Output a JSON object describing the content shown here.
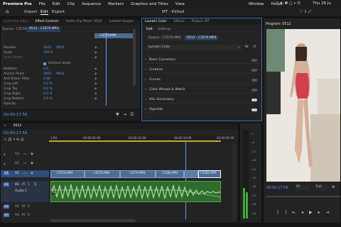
{
  "menubar": {
    "app": "Premiere Pro",
    "items": [
      "File",
      "Edit",
      "Clip",
      "Sequence",
      "Markers",
      "Graphics and Titles",
      "View",
      "Window",
      "Help"
    ],
    "datetime": "Thu 26 Ju"
  },
  "header": {
    "home_icon": "home-icon",
    "tabs": [
      "Import",
      "Edit",
      "Export"
    ],
    "active_tab": "Edit",
    "title": "MT - Edited"
  },
  "effect_controls": {
    "tabs": [
      "Effect Controls",
      "Audio Clip Mixer: 0512",
      "Lumetri Scopes"
    ],
    "source": "Source · C3579.MP4",
    "sequence": "0512 · C3579.MP4",
    "clip_label": "C3579.MP4",
    "rows": [
      {
        "label": "Position",
        "v1": "1852",
        "v2": "9952"
      },
      {
        "label": "Scale",
        "v1": "100.0",
        "v2": ""
      },
      {
        "label": "Scale Width",
        "v1": "",
        "v2": ""
      },
      {
        "label": "Uniform Scale",
        "v1": "",
        "v2": ""
      },
      {
        "label": "Rotation",
        "v1": "0.0",
        "v2": ""
      },
      {
        "label": "Anchor Point",
        "v1": "1852",
        "v2": "9952"
      },
      {
        "label": "Anti-flicker Filter",
        "v1": "0.00",
        "v2": ""
      },
      {
        "label": "Crop Left",
        "v1": "0.0 %",
        "v2": ""
      },
      {
        "label": "Crop Top",
        "v1": "0.0 %",
        "v2": ""
      },
      {
        "label": "Crop Right",
        "v1": "0.0 %",
        "v2": ""
      },
      {
        "label": "Crop Bottom",
        "v1": "0.0 %",
        "v2": ""
      },
      {
        "label": "Opacity",
        "v1": "",
        "v2": ""
      }
    ],
    "timecode": "00:00:17:56"
  },
  "lumetri": {
    "tabs": [
      "Lumetri Color",
      "Effects",
      "Project: MT"
    ],
    "subtabs": [
      "Edit",
      "Settings"
    ],
    "source": "Source - C3579.MP4",
    "sequence": "0512 - C3579.MP4",
    "effect_name": "Lumetri Color",
    "sections": [
      {
        "label": "Basic Correction",
        "on": false
      },
      {
        "label": "Creative",
        "on": false
      },
      {
        "label": "Curves",
        "on": false
      },
      {
        "label": "Color Wheels & Match",
        "on": false
      },
      {
        "label": "HSL Secondary",
        "on": true
      },
      {
        "label": "Vignette",
        "on": true
      }
    ]
  },
  "program": {
    "title": "Program: 0512",
    "timecode": "00:00:17:56",
    "fit": "Fit",
    "quality": "Full",
    "controls": [
      "mark-in-icon",
      "mark-out-icon",
      "go-to-in-icon",
      "step-back-icon",
      "play-icon",
      "step-forward-icon",
      "go-to-out-icon"
    ]
  },
  "timeline": {
    "sequence_tab": "0512",
    "timecode": "00:00:17:56",
    "ruler": [
      "1:00",
      "00:00:05:00",
      "00:00:10:00",
      "00:00:15:00",
      "00:00:20:00"
    ],
    "tracks": [
      "V3",
      "V2",
      "V1",
      "A1",
      "A2",
      "A3"
    ],
    "audio_label": "Audio 1",
    "clips": [
      "C3578.MP4",
      "C3579.MP4",
      "C3579.MP4",
      "C3580.MP4",
      "C3582.MP4"
    ],
    "meter_ticks": [
      "0",
      "-6",
      "-12",
      "-18",
      "-24",
      "-30",
      "-36",
      "-42",
      "-48",
      "-54"
    ]
  }
}
